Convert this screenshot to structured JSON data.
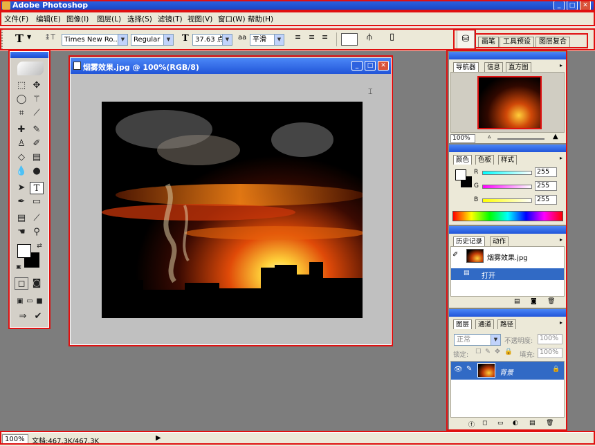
{
  "app": {
    "title": "Adobe Photoshop"
  },
  "menu": [
    "文件(F)",
    "编辑(E)",
    "图像(I)",
    "图层(L)",
    "选择(S)",
    "滤镜(T)",
    "视图(V)",
    "窗口(W)",
    "帮助(H)"
  ],
  "options": {
    "tool_glyph": "T",
    "font_family": "Times New Ro...",
    "font_style": "Regular",
    "font_size": "37.63 点",
    "aa_prefix": "aa",
    "antialias": "平滑",
    "palette_tabs": [
      "画笔",
      "工具预设",
      "图层复合"
    ]
  },
  "document": {
    "title": "烟雾效果.jpg @ 100%(RGB/8)"
  },
  "navigator": {
    "tabs": [
      "导航器",
      "信息",
      "直方图"
    ],
    "zoom": "100%"
  },
  "color": {
    "tabs": [
      "颜色",
      "色板",
      "样式"
    ],
    "channels": [
      {
        "label": "R",
        "value": "255"
      },
      {
        "label": "G",
        "value": "255"
      },
      {
        "label": "B",
        "value": "255"
      }
    ]
  },
  "history": {
    "tabs": [
      "历史记录",
      "动作"
    ],
    "snapshot": "烟雾效果.jpg",
    "step": "打开"
  },
  "layers": {
    "tabs": [
      "图层",
      "通道",
      "路径"
    ],
    "blend_mode": "正常",
    "opacity_label": "不透明度:",
    "opacity": "100%",
    "lock_label": "锁定:",
    "fill_label": "填充:",
    "fill": "100%",
    "layer_name": "背景"
  },
  "status": {
    "zoom": "100%",
    "doc_size": "文档:467.3K/467.3K"
  }
}
